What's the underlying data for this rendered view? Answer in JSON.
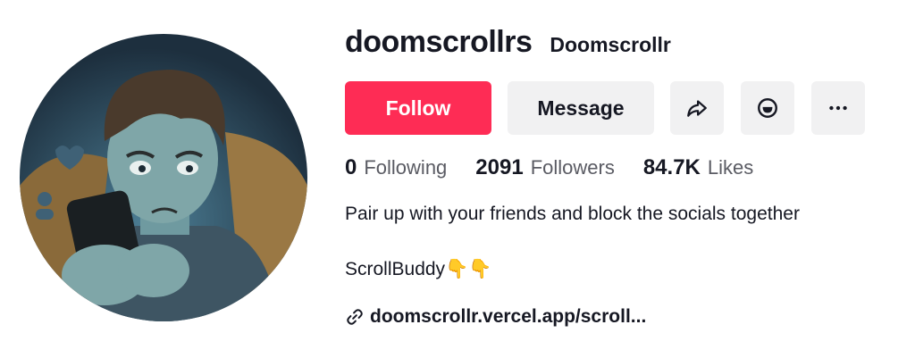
{
  "profile": {
    "username": "doomscrollrs",
    "nickname": "Doomscrollr",
    "avatar_icon": "avatar-person-scrolling-phone"
  },
  "actions": {
    "follow_label": "Follow",
    "message_label": "Message",
    "share_icon": "share-arrow-icon",
    "emoji_icon": "smile-face-icon",
    "more_icon": "more-dots-icon"
  },
  "stats": {
    "following_count": "0",
    "following_label": "Following",
    "followers_count": "2091",
    "followers_label": "Followers",
    "likes_count": "84.7K",
    "likes_label": "Likes"
  },
  "bio": {
    "line1": "Pair up with your friends and block the socials together",
    "line2": "ScrollBuddy👇👇",
    "link": "doomscrollr.vercel.app/scroll..."
  },
  "colors": {
    "accent": "#fe2c55",
    "button_bg": "#f1f1f2",
    "text": "#161823",
    "muted": "#5a5b63"
  }
}
